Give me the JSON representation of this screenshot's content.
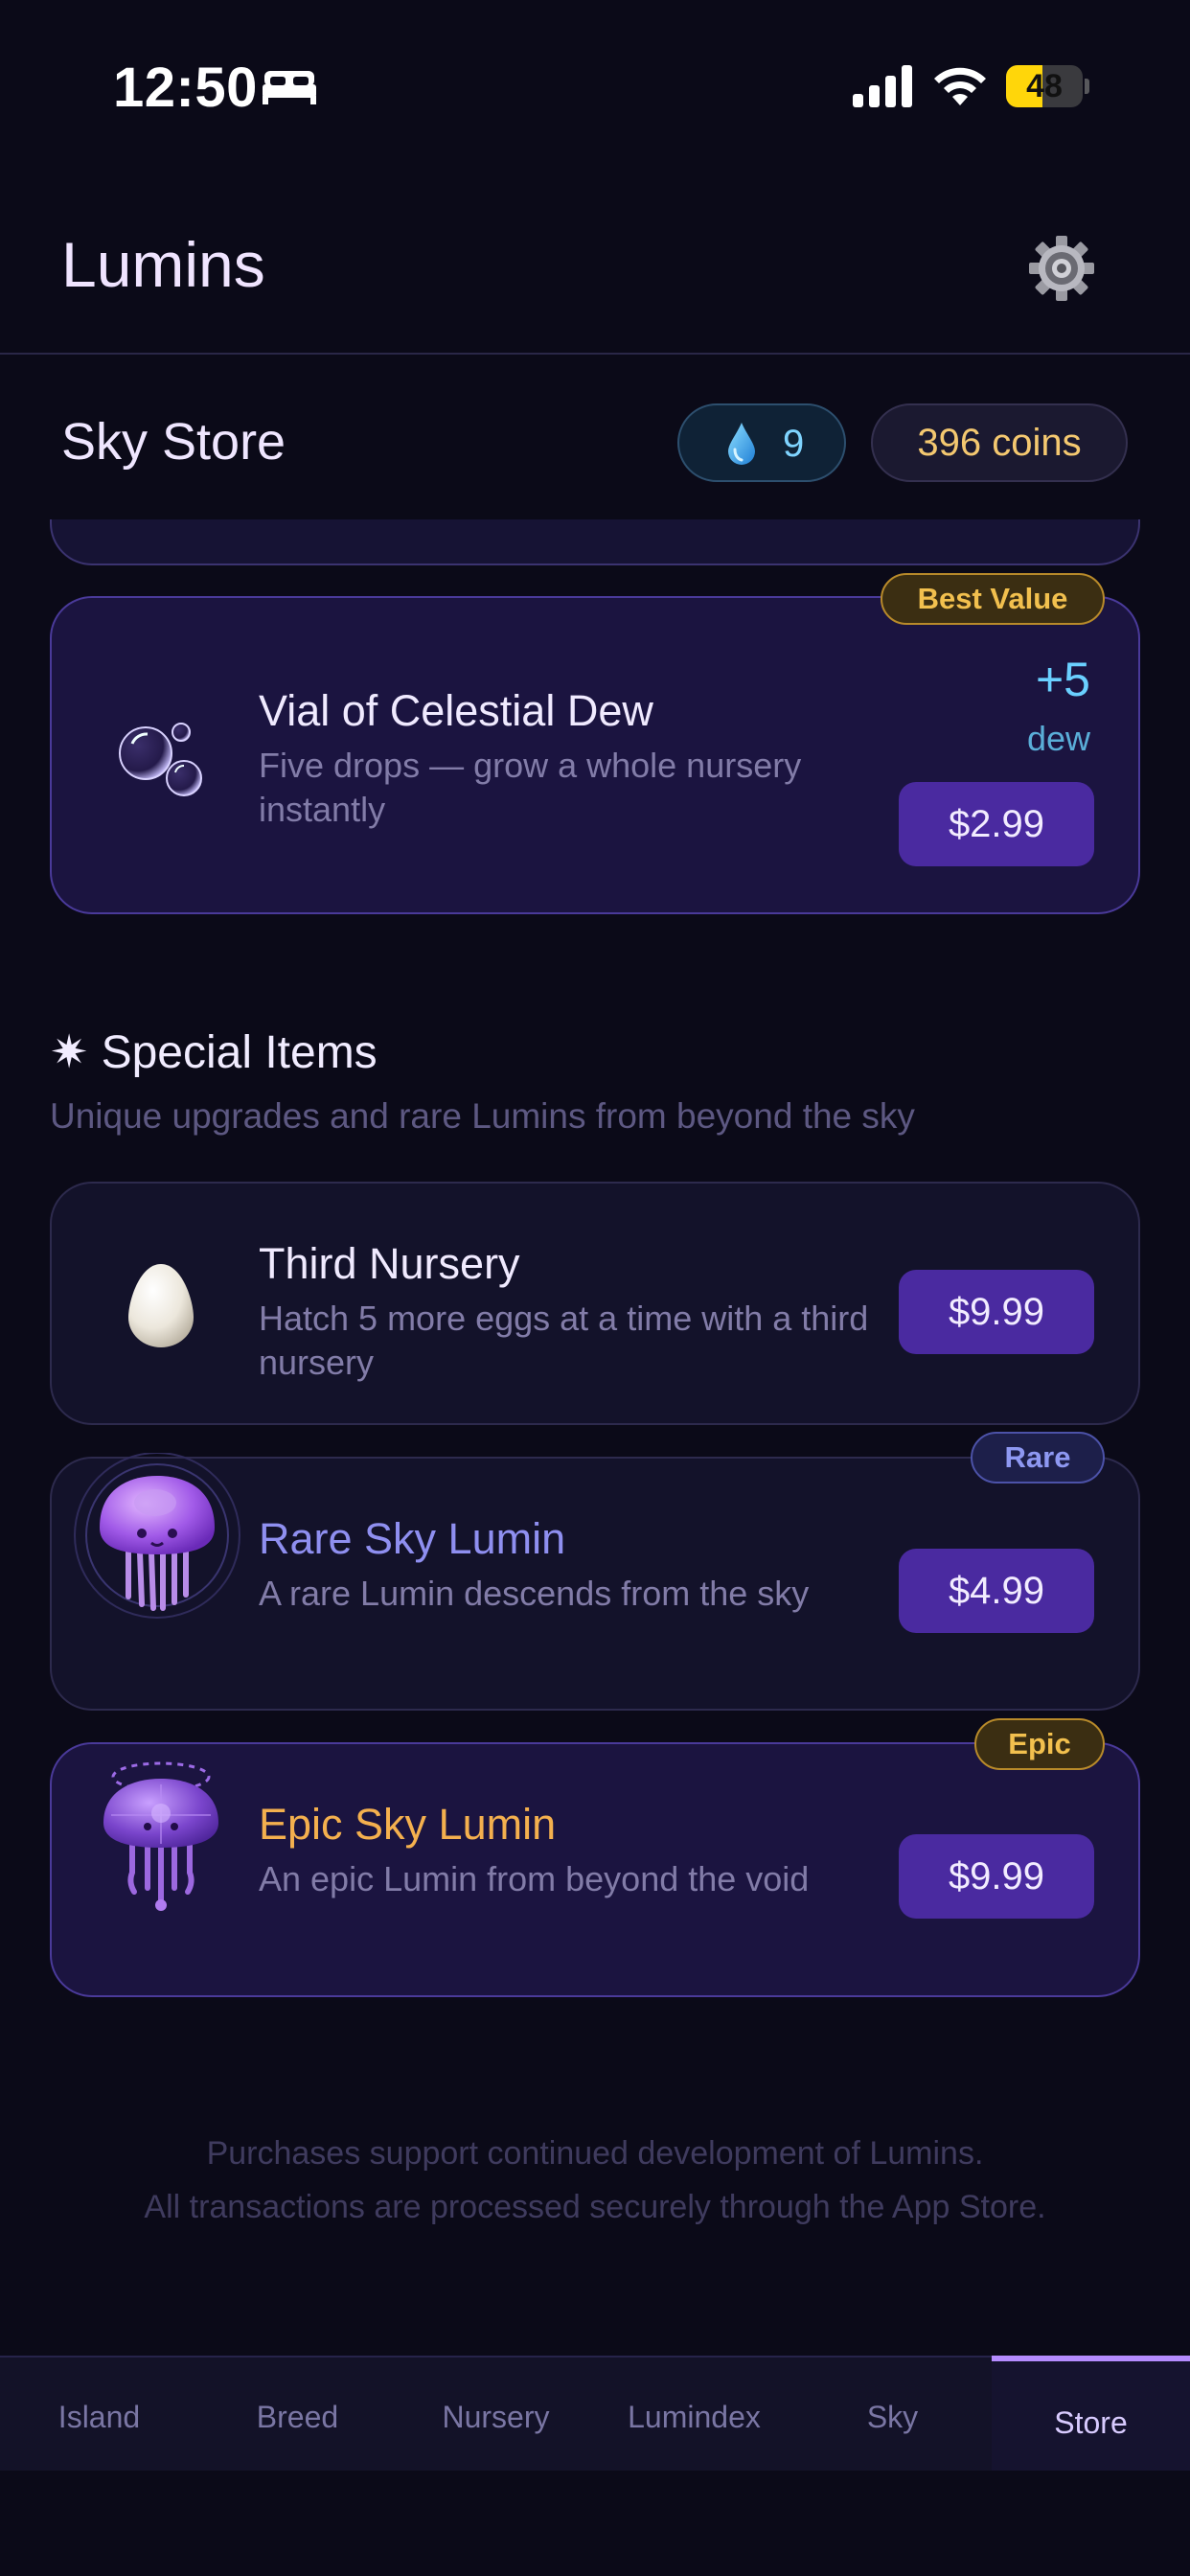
{
  "status_bar": {
    "time": "12:50",
    "battery_level": "48",
    "battery_fraction": 0.48,
    "icons": [
      "sleep-icon",
      "signal-icon",
      "wifi-icon",
      "battery-icon"
    ]
  },
  "header": {
    "title": "Lumins",
    "settings_icon": "gear-icon"
  },
  "store": {
    "title": "Sky Store",
    "dew": {
      "icon": "water-drop-icon",
      "value": "9"
    },
    "coins": "396 coins"
  },
  "dew_item": {
    "badge": "Best Value",
    "icon": "bubbles-icon",
    "title": "Vial of Celestial Dew",
    "description": "Five drops — grow a whole nursery instantly",
    "amount": "+5",
    "unit": "dew",
    "price": "$2.99"
  },
  "special": {
    "glyph": "✷",
    "title": "Special Items",
    "subtitle": "Unique upgrades and rare Lumins from beyond the sky",
    "items": [
      {
        "icon": "egg-icon",
        "title": "Third Nursery",
        "description": "Hatch 5 more eggs at a time with a third nursery",
        "price": "$9.99"
      },
      {
        "badge": "Rare",
        "icon": "rare-jellyfish-icon",
        "title": "Rare Sky Lumin",
        "description": "A rare Lumin descends from the sky",
        "price": "$4.99"
      },
      {
        "badge": "Epic",
        "icon": "epic-jellyfish-icon",
        "title": "Epic Sky Lumin",
        "description": "An epic Lumin from beyond the void",
        "price": "$9.99"
      }
    ]
  },
  "footer": {
    "line1": "Purchases support continued development of Lumins.",
    "line2": "All transactions are processed securely through the App Store."
  },
  "nav": {
    "tabs": [
      "Island",
      "Breed",
      "Nursery",
      "Lumindex",
      "Sky",
      "Store"
    ],
    "active": "Store"
  },
  "colors": {
    "background": "#0b0a18",
    "accent_purple": "#4a2aa0",
    "gold": "#f2c04e",
    "dew_blue": "#7fd4ff",
    "rare_blue": "#8e98f2",
    "epic_orange": "#f4b04e"
  }
}
